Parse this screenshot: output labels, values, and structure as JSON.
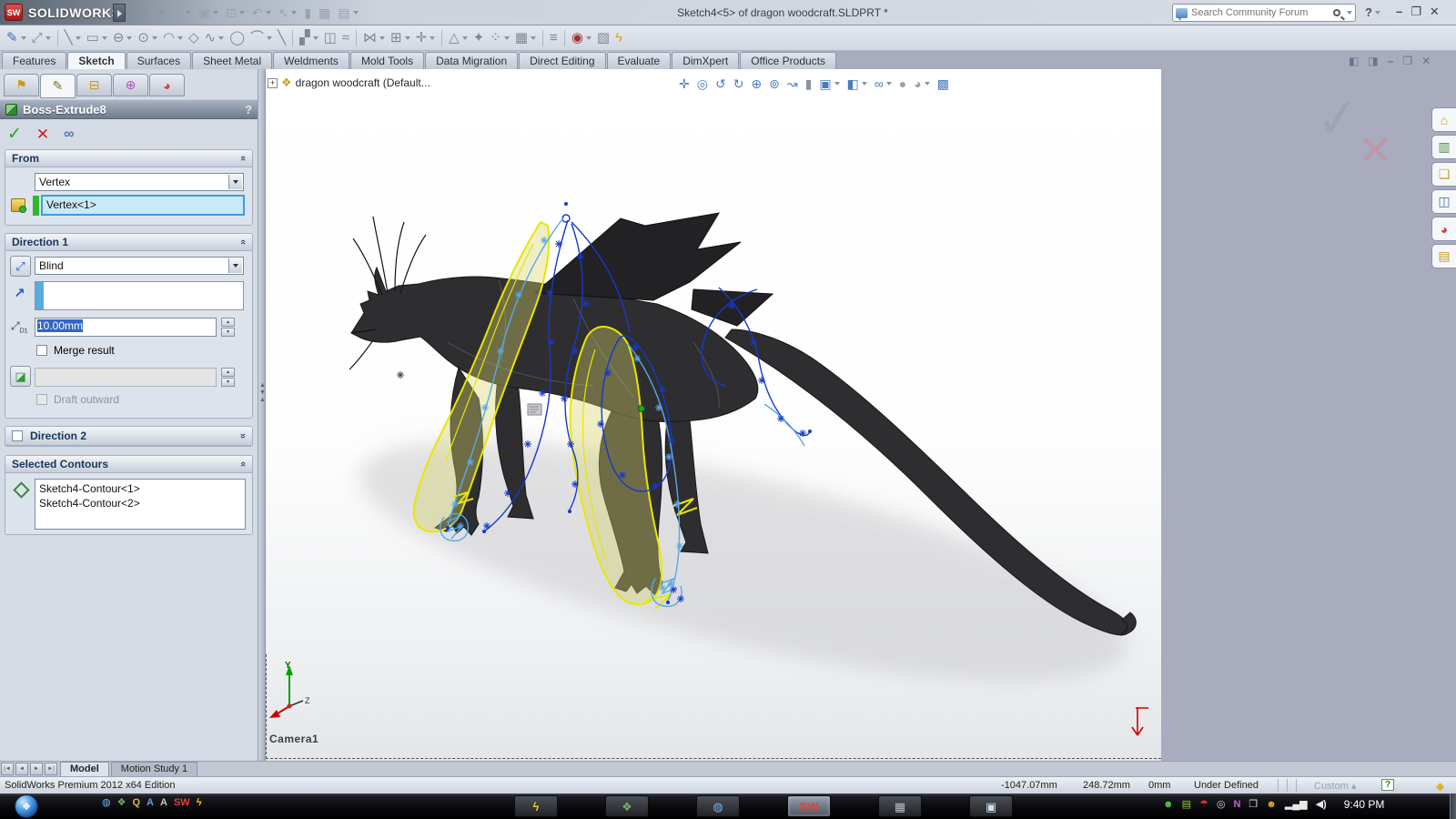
{
  "window": {
    "logo": "SW",
    "brand": "SOLIDWORKS",
    "title": "Sketch4<5> of dragon woodcraft.SLDPRT *",
    "search_placeholder": "Search Community Forum",
    "help_glyph": "?",
    "controls": [
      {
        "name": "minimize-button",
        "glyph": "–"
      },
      {
        "name": "restore-button",
        "glyph": "❐"
      },
      {
        "name": "close-button",
        "glyph": "✕"
      }
    ]
  },
  "toolbar_top": {
    "icons": [
      {
        "name": "new-document-icon",
        "glyph": "▯",
        "caret": true
      },
      {
        "name": "open-icon",
        "glyph": "◰",
        "caret": true
      },
      {
        "name": "save-icon",
        "glyph": "▣",
        "caret": true
      },
      {
        "name": "print-icon",
        "glyph": "⊡",
        "caret": true
      },
      {
        "name": "undo-icon",
        "glyph": "↶",
        "caret": true
      },
      {
        "name": "select-icon",
        "glyph": "↖",
        "caret": true
      },
      {
        "name": "rebuild-icon",
        "glyph": "▮"
      },
      {
        "name": "file-properties-icon",
        "glyph": "▦"
      },
      {
        "name": "options-icon",
        "glyph": "▤",
        "caret": true
      }
    ]
  },
  "toolbar_sketch": {
    "icons": [
      {
        "name": "sketch-exit-icon",
        "glyph": "✎",
        "color": "#3b6cc0",
        "caret": true
      },
      {
        "name": "smart-dimension-icon",
        "glyph": "⤢",
        "caret": true
      },
      {
        "divider": true
      },
      {
        "name": "line-icon",
        "glyph": "╲",
        "caret": true
      },
      {
        "name": "rectangle-icon",
        "glyph": "▭",
        "caret": true
      },
      {
        "name": "slot-icon",
        "glyph": "⊖",
        "caret": true
      },
      {
        "name": "circle-icon",
        "glyph": "⊙",
        "caret": true
      },
      {
        "name": "arc-icon",
        "glyph": "◠",
        "caret": true
      },
      {
        "name": "polygon-icon",
        "glyph": "◇"
      },
      {
        "name": "spline-icon",
        "glyph": "∿",
        "caret": true
      },
      {
        "name": "ellipse-icon",
        "glyph": "◯"
      },
      {
        "name": "fillet-icon",
        "glyph": "⌒",
        "caret": true
      },
      {
        "name": "centerline-icon",
        "glyph": "╲"
      },
      {
        "divider": true
      },
      {
        "name": "trim-icon",
        "glyph": "▞",
        "caret": true
      },
      {
        "name": "convert-entities-icon",
        "glyph": "◫"
      },
      {
        "name": "offset-icon",
        "glyph": "≈"
      },
      {
        "divider": true
      },
      {
        "name": "mirror-icon",
        "glyph": "⋈",
        "caret": true
      },
      {
        "name": "linear-pattern-icon",
        "glyph": "⊞",
        "caret": true
      },
      {
        "name": "move-entities-icon",
        "glyph": "✛",
        "caret": true
      },
      {
        "divider": true
      },
      {
        "name": "display-relations-icon",
        "glyph": "△",
        "caret": true
      },
      {
        "name": "repair-sketch-icon",
        "glyph": "✦"
      },
      {
        "name": "quick-snaps-icon",
        "glyph": "⁘",
        "caret": true
      },
      {
        "name": "rapid-sketch-icon",
        "glyph": "▦",
        "caret": true
      },
      {
        "divider": true
      },
      {
        "name": "instant2d-icon",
        "glyph": "≡"
      },
      {
        "divider": true
      },
      {
        "name": "camera-icon",
        "glyph": "◉",
        "color": "#a03030",
        "caret": true
      },
      {
        "name": "sketch-picture-icon",
        "glyph": "▧"
      },
      {
        "name": "instant3d-icon",
        "glyph": "ϟ",
        "color": "#d8a820"
      }
    ]
  },
  "commandmanager": {
    "tabs": [
      {
        "label": "Features"
      },
      {
        "label": "Sketch",
        "active": true
      },
      {
        "label": "Surfaces"
      },
      {
        "label": "Sheet Metal"
      },
      {
        "label": "Weldments"
      },
      {
        "label": "Mold Tools"
      },
      {
        "label": "Data Migration"
      },
      {
        "label": "Direct Editing"
      },
      {
        "label": "Evaluate"
      },
      {
        "label": "DimXpert"
      },
      {
        "label": "Office Products"
      }
    ]
  },
  "property_manager": {
    "tabs": [
      {
        "name": "featuremanager-tab-icon",
        "glyph": "⚑",
        "color": "#c89a20"
      },
      {
        "name": "propertymanager-tab-icon",
        "glyph": "✎",
        "color": "#8a6d1d",
        "active": true
      },
      {
        "name": "configurationmanager-tab-icon",
        "glyph": "⊟",
        "color": "#c89a20"
      },
      {
        "name": "dimxpertmanager-tab-icon",
        "glyph": "⊕",
        "color": "#b050c0"
      },
      {
        "name": "displaymanager-tab-icon",
        "glyph": "◕",
        "color": "#d04040"
      }
    ],
    "title": "Boss-Extrude8",
    "help": "?",
    "ok_glyph": "✓",
    "cancel_glyph": "✕",
    "preview_glyph": "∞",
    "from": {
      "title": "From",
      "condition": "Vertex",
      "selection": "Vertex<1>"
    },
    "direction1": {
      "title": "Direction 1",
      "condition": "Blind",
      "reverse_glyph": "⤢",
      "arrow_glyph": "↗",
      "depth_label": "D1",
      "depth": "10.00mm",
      "merge_label": "Merge result",
      "draft_glyph": "◪",
      "draft_label": "Draft outward"
    },
    "direction2": {
      "title": "Direction 2"
    },
    "contours": {
      "title": "Selected Contours",
      "items": [
        "Sketch4-Contour<1>",
        "Sketch4-Contour<2>"
      ]
    }
  },
  "viewport": {
    "expand_glyph": "+",
    "tree_label": "dragon woodcraft  (Default...",
    "headsup": [
      {
        "name": "pan-icon",
        "glyph": "✛"
      },
      {
        "name": "zoom-fit-icon",
        "glyph": "◎"
      },
      {
        "name": "rotate-left-icon",
        "glyph": "↺"
      },
      {
        "name": "rotate-view-icon",
        "glyph": "↻"
      },
      {
        "name": "zoom-in-icon",
        "glyph": "⊕"
      },
      {
        "name": "zoom-area-icon",
        "glyph": "⊚"
      },
      {
        "name": "fly-icon",
        "glyph": "↝"
      },
      {
        "name": "section-view-icon",
        "glyph": "▮",
        "color": "#8a93a0"
      },
      {
        "name": "view-orientation-icon",
        "glyph": "▣",
        "caret": true
      },
      {
        "name": "display-style-icon",
        "glyph": "◧",
        "caret": true
      },
      {
        "name": "hide-show-icon",
        "glyph": "∞",
        "caret": true
      },
      {
        "name": "shadow-icon",
        "glyph": "●",
        "color": "#9aa2ae"
      },
      {
        "name": "appearance-icon",
        "glyph": "◕",
        "color": "#9aa2ae",
        "caret": true
      },
      {
        "name": "scene-icon",
        "glyph": "▩"
      }
    ],
    "camera_label": "Camera1",
    "triad": {
      "y": "Y",
      "z": "Z"
    }
  },
  "right_pane": {
    "doc_controls": [
      {
        "name": "tile-left-icon",
        "glyph": "◧"
      },
      {
        "name": "tile-right-icon",
        "glyph": "◨"
      },
      {
        "name": "doc-minimize-icon",
        "glyph": "–"
      },
      {
        "name": "doc-restore-icon",
        "glyph": "❐"
      },
      {
        "name": "doc-close-icon",
        "glyph": "✕"
      }
    ],
    "ghost_check": "✓",
    "ghost_x": "✕",
    "task_pane": [
      {
        "name": "resources-home-icon",
        "glyph": "⌂",
        "color": "#c89a20"
      },
      {
        "name": "design-library-icon",
        "glyph": "▥",
        "color": "#4a8a4a"
      },
      {
        "name": "file-explorer-icon",
        "glyph": "❏",
        "color": "#c8a028"
      },
      {
        "name": "view-palette-icon",
        "glyph": "◫",
        "color": "#4a6ab0"
      },
      {
        "name": "appearances-icon",
        "glyph": "◕",
        "color": "#d04040"
      },
      {
        "name": "custom-properties-icon",
        "glyph": "▤",
        "color": "#c89a20"
      }
    ]
  },
  "bottom_bar": {
    "nav": [
      "|◄",
      "◄",
      "►",
      "►|"
    ],
    "tabs": [
      {
        "label": "Model",
        "active": true
      },
      {
        "label": "Motion Study 1"
      }
    ]
  },
  "status_bar": {
    "edition": "SolidWorks Premium 2012 x64 Edition",
    "x": "-1047.07mm",
    "y": "248.72mm",
    "z": "0mm",
    "state": "Under Defined",
    "custom": "Custom",
    "help_glyph": "?",
    "tag_glyph": "◆"
  },
  "taskbar": {
    "start_glyph": "❖",
    "quick": [
      {
        "name": "media-player-icon",
        "glyph": "◍",
        "color": "#7ab0e8"
      },
      {
        "name": "explorer-icon",
        "glyph": "❖",
        "color": "#72b06a"
      },
      {
        "name": "quicktime-icon",
        "glyph": "Q",
        "color": "#d8b84a"
      },
      {
        "name": "maps-icon",
        "glyph": "A",
        "color": "#6a9ae0"
      },
      {
        "name": "acrobat-icon",
        "glyph": "A",
        "color": "#c8c8c8"
      },
      {
        "name": "solidworks-quick-icon",
        "glyph": "SW",
        "color": "#e04040"
      },
      {
        "name": "lightning-icon",
        "glyph": "ϟ",
        "color": "#e8c830"
      }
    ],
    "buttons": [
      {
        "name": "task-lightning-button",
        "glyph": "ϟ",
        "color": "#e8c830"
      },
      {
        "name": "task-explorer-button",
        "glyph": "❖",
        "color": "#72b06a"
      },
      {
        "name": "task-network-button",
        "glyph": "◍",
        "color": "#7ab0e8"
      },
      {
        "name": "task-solidworks-button",
        "glyph": "SW",
        "color": "#e04040",
        "active": true
      },
      {
        "name": "task-photo-button",
        "glyph": "▦",
        "color": "#b8bcc8"
      },
      {
        "name": "task-image-button",
        "glyph": "▣",
        "color": "#cfe0ee"
      }
    ],
    "tray": [
      {
        "name": "messenger-icon",
        "glyph": "☻",
        "color": "#58c858"
      },
      {
        "name": "tasklist-icon",
        "glyph": "▤",
        "color": "#90c840"
      },
      {
        "name": "antivirus-icon",
        "glyph": "☂",
        "color": "#e03030"
      },
      {
        "name": "timer-icon",
        "glyph": "◎",
        "color": "#d8d8d8"
      },
      {
        "name": "onenote-icon",
        "glyph": "N",
        "color": "#c060d0"
      },
      {
        "name": "clipboard-icon",
        "glyph": "❒",
        "color": "#d8d8d8"
      },
      {
        "name": "users-icon",
        "glyph": "☻",
        "color": "#d8a830"
      },
      {
        "name": "network-signal-icon",
        "glyph": "▂▄▆",
        "color": "#e8e8e8"
      },
      {
        "name": "volume-icon",
        "glyph": "◀)",
        "color": "#e8e8e8"
      }
    ],
    "time": "9:40 PM"
  },
  "ui": {
    "chevron": "«",
    "spin_up": "▲",
    "spin_down": "▼"
  },
  "colors": {
    "model": "#2e2e31",
    "wing": "#222225",
    "detail": "#55555c",
    "contour": "#e9e600",
    "contour_fill": "#d8d66a",
    "spline": "#1738c8",
    "spline_light": "#56a9eb",
    "shadow": "#c6c6c9",
    "origin": "#1fa51f"
  }
}
